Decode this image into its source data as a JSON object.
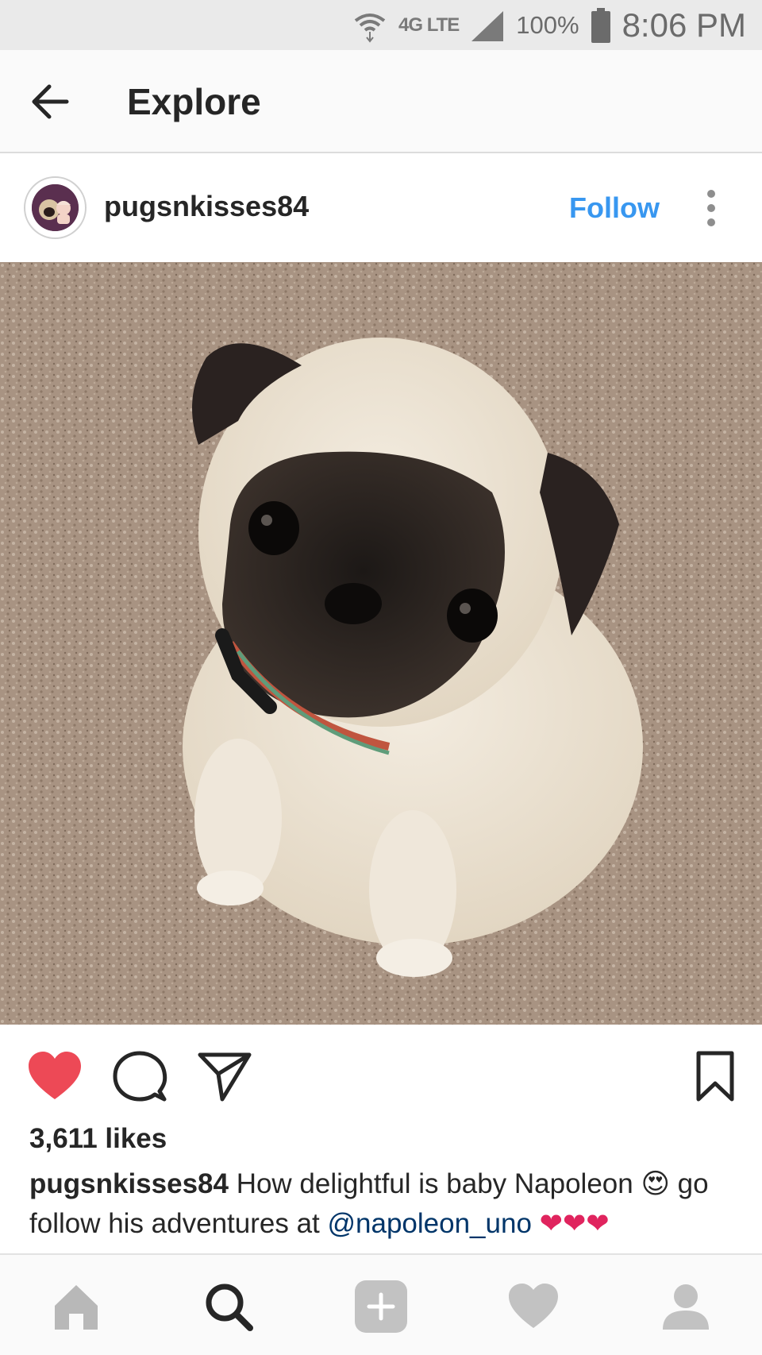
{
  "status_bar": {
    "network": "4G LTE",
    "battery": "100%",
    "time": "8:06 PM"
  },
  "header": {
    "title": "Explore",
    "back_icon": "arrow-left-icon"
  },
  "post": {
    "username": "pugsnkisses84",
    "follow_label": "Follow",
    "more_icon": "more-vertical-icon",
    "photo_subject": "pug-puppy-photo",
    "liked": true,
    "likes": "3,611 likes",
    "caption": {
      "user": "pugsnkisses84",
      "text_1": " How delightful is baby Napoleon ",
      "emoji": "😍",
      "text_2": " go follow his adventures at ",
      "mention": "@napoleon_uno",
      "hearts": " ❤❤❤"
    }
  },
  "actions": {
    "like_icon": "heart-filled-icon",
    "comment_icon": "comment-icon",
    "share_icon": "send-icon",
    "save_icon": "bookmark-icon"
  },
  "bottom_nav": {
    "items": [
      "home-icon",
      "search-icon",
      "add-icon",
      "activity-heart-icon",
      "profile-icon"
    ],
    "active": "search-icon"
  },
  "colors": {
    "accent": "#3897f0",
    "like": "#ed4956",
    "mention": "#003569"
  }
}
